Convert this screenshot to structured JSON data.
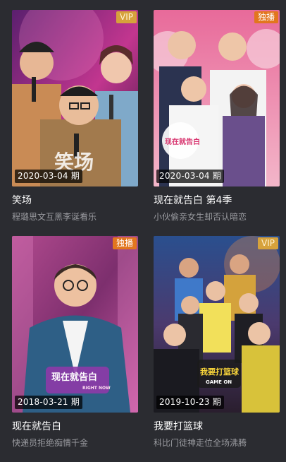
{
  "cards": [
    {
      "badge": "VIP",
      "badge_type": "vip",
      "date": "2020-03-04 期",
      "title": "笑场",
      "subtitle": "程璐思文互黑李诞看乐",
      "poster_text": "笑场"
    },
    {
      "badge": "独播",
      "badge_type": "exclusive",
      "date": "2020-03-04 期",
      "title": "现在就告白 第4季",
      "subtitle": "小伙偷亲女生却否认暗恋",
      "poster_text": "现在就告白"
    },
    {
      "badge": "独播",
      "badge_type": "exclusive",
      "date": "2018-03-21 期",
      "title": "现在就告白",
      "subtitle": "快递员拒绝痴情千金",
      "poster_text": "现在就告白",
      "poster_text_en": "RIGHT NOW"
    },
    {
      "badge": "VIP",
      "badge_type": "vip",
      "date": "2019-10-23 期",
      "title": "我要打篮球",
      "subtitle": "科比门徒神走位全场沸腾",
      "poster_text": "我要打篮球",
      "poster_text_en": "GAME ON"
    }
  ],
  "colors": {
    "background": "#2b2c31",
    "vip_badge": "#d6a23c",
    "exclusive_badge": "#e2761e",
    "subtitle": "#9a9ba0"
  }
}
